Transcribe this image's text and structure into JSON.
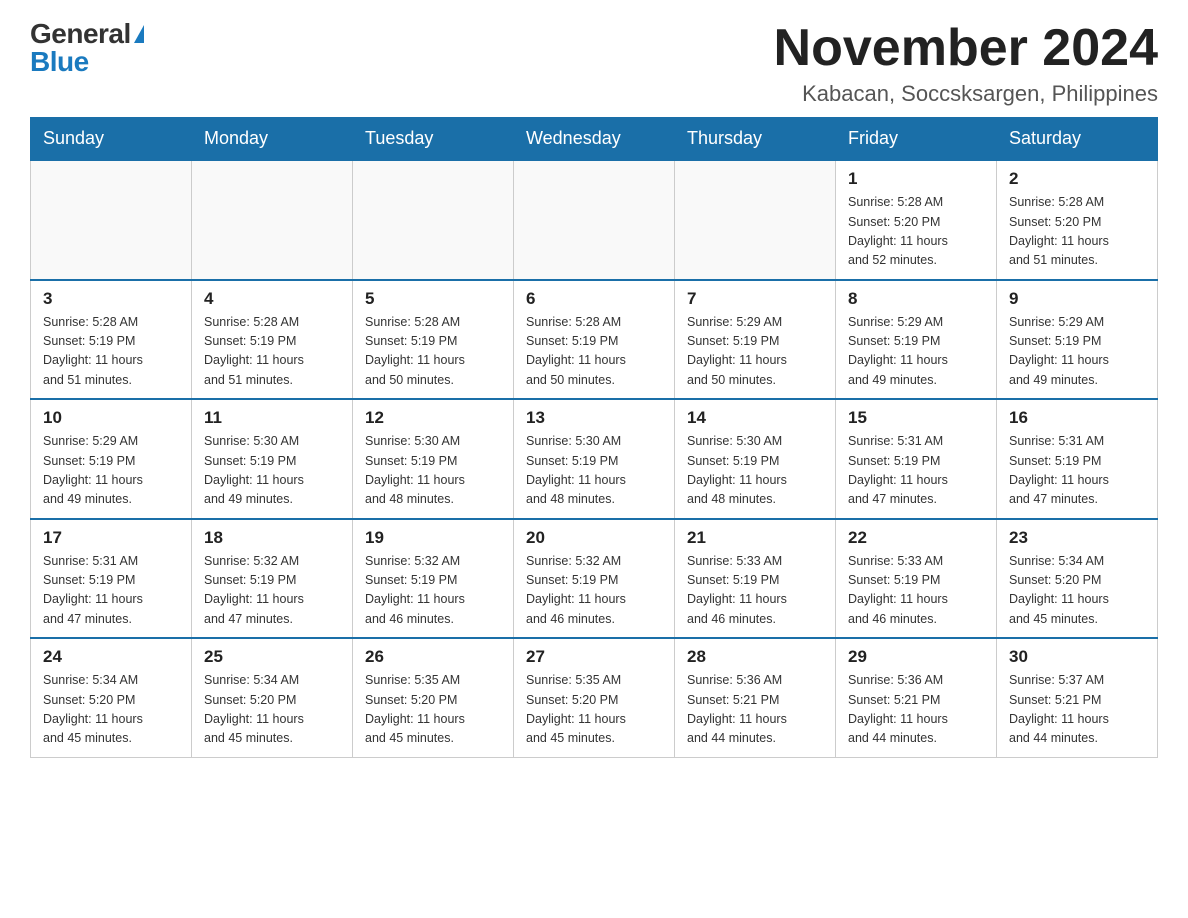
{
  "logo": {
    "general": "General",
    "blue": "Blue"
  },
  "title": {
    "month": "November 2024",
    "location": "Kabacan, Soccsksargen, Philippines"
  },
  "days_header": [
    "Sunday",
    "Monday",
    "Tuesday",
    "Wednesday",
    "Thursday",
    "Friday",
    "Saturday"
  ],
  "weeks": [
    [
      {
        "day": "",
        "info": ""
      },
      {
        "day": "",
        "info": ""
      },
      {
        "day": "",
        "info": ""
      },
      {
        "day": "",
        "info": ""
      },
      {
        "day": "",
        "info": ""
      },
      {
        "day": "1",
        "info": "Sunrise: 5:28 AM\nSunset: 5:20 PM\nDaylight: 11 hours\nand 52 minutes."
      },
      {
        "day": "2",
        "info": "Sunrise: 5:28 AM\nSunset: 5:20 PM\nDaylight: 11 hours\nand 51 minutes."
      }
    ],
    [
      {
        "day": "3",
        "info": "Sunrise: 5:28 AM\nSunset: 5:19 PM\nDaylight: 11 hours\nand 51 minutes."
      },
      {
        "day": "4",
        "info": "Sunrise: 5:28 AM\nSunset: 5:19 PM\nDaylight: 11 hours\nand 51 minutes."
      },
      {
        "day": "5",
        "info": "Sunrise: 5:28 AM\nSunset: 5:19 PM\nDaylight: 11 hours\nand 50 minutes."
      },
      {
        "day": "6",
        "info": "Sunrise: 5:28 AM\nSunset: 5:19 PM\nDaylight: 11 hours\nand 50 minutes."
      },
      {
        "day": "7",
        "info": "Sunrise: 5:29 AM\nSunset: 5:19 PM\nDaylight: 11 hours\nand 50 minutes."
      },
      {
        "day": "8",
        "info": "Sunrise: 5:29 AM\nSunset: 5:19 PM\nDaylight: 11 hours\nand 49 minutes."
      },
      {
        "day": "9",
        "info": "Sunrise: 5:29 AM\nSunset: 5:19 PM\nDaylight: 11 hours\nand 49 minutes."
      }
    ],
    [
      {
        "day": "10",
        "info": "Sunrise: 5:29 AM\nSunset: 5:19 PM\nDaylight: 11 hours\nand 49 minutes."
      },
      {
        "day": "11",
        "info": "Sunrise: 5:30 AM\nSunset: 5:19 PM\nDaylight: 11 hours\nand 49 minutes."
      },
      {
        "day": "12",
        "info": "Sunrise: 5:30 AM\nSunset: 5:19 PM\nDaylight: 11 hours\nand 48 minutes."
      },
      {
        "day": "13",
        "info": "Sunrise: 5:30 AM\nSunset: 5:19 PM\nDaylight: 11 hours\nand 48 minutes."
      },
      {
        "day": "14",
        "info": "Sunrise: 5:30 AM\nSunset: 5:19 PM\nDaylight: 11 hours\nand 48 minutes."
      },
      {
        "day": "15",
        "info": "Sunrise: 5:31 AM\nSunset: 5:19 PM\nDaylight: 11 hours\nand 47 minutes."
      },
      {
        "day": "16",
        "info": "Sunrise: 5:31 AM\nSunset: 5:19 PM\nDaylight: 11 hours\nand 47 minutes."
      }
    ],
    [
      {
        "day": "17",
        "info": "Sunrise: 5:31 AM\nSunset: 5:19 PM\nDaylight: 11 hours\nand 47 minutes."
      },
      {
        "day": "18",
        "info": "Sunrise: 5:32 AM\nSunset: 5:19 PM\nDaylight: 11 hours\nand 47 minutes."
      },
      {
        "day": "19",
        "info": "Sunrise: 5:32 AM\nSunset: 5:19 PM\nDaylight: 11 hours\nand 46 minutes."
      },
      {
        "day": "20",
        "info": "Sunrise: 5:32 AM\nSunset: 5:19 PM\nDaylight: 11 hours\nand 46 minutes."
      },
      {
        "day": "21",
        "info": "Sunrise: 5:33 AM\nSunset: 5:19 PM\nDaylight: 11 hours\nand 46 minutes."
      },
      {
        "day": "22",
        "info": "Sunrise: 5:33 AM\nSunset: 5:19 PM\nDaylight: 11 hours\nand 46 minutes."
      },
      {
        "day": "23",
        "info": "Sunrise: 5:34 AM\nSunset: 5:20 PM\nDaylight: 11 hours\nand 45 minutes."
      }
    ],
    [
      {
        "day": "24",
        "info": "Sunrise: 5:34 AM\nSunset: 5:20 PM\nDaylight: 11 hours\nand 45 minutes."
      },
      {
        "day": "25",
        "info": "Sunrise: 5:34 AM\nSunset: 5:20 PM\nDaylight: 11 hours\nand 45 minutes."
      },
      {
        "day": "26",
        "info": "Sunrise: 5:35 AM\nSunset: 5:20 PM\nDaylight: 11 hours\nand 45 minutes."
      },
      {
        "day": "27",
        "info": "Sunrise: 5:35 AM\nSunset: 5:20 PM\nDaylight: 11 hours\nand 45 minutes."
      },
      {
        "day": "28",
        "info": "Sunrise: 5:36 AM\nSunset: 5:21 PM\nDaylight: 11 hours\nand 44 minutes."
      },
      {
        "day": "29",
        "info": "Sunrise: 5:36 AM\nSunset: 5:21 PM\nDaylight: 11 hours\nand 44 minutes."
      },
      {
        "day": "30",
        "info": "Sunrise: 5:37 AM\nSunset: 5:21 PM\nDaylight: 11 hours\nand 44 minutes."
      }
    ]
  ]
}
